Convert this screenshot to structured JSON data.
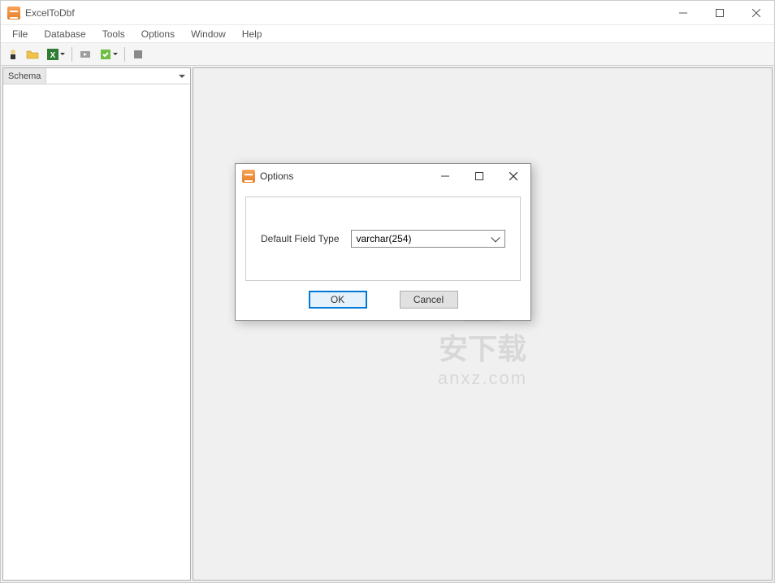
{
  "app": {
    "title": "ExcelToDbf"
  },
  "menu": {
    "file": "File",
    "database": "Database",
    "tools": "Tools",
    "options": "Options",
    "window": "Window",
    "help": "Help"
  },
  "toolbar": {
    "icons": [
      "wizard-icon",
      "open-icon",
      "excel-icon",
      "run-icon",
      "task-icon",
      "stop-icon"
    ]
  },
  "sidebar": {
    "schema_label": "Schema",
    "schema_selected": ""
  },
  "dialog": {
    "title": "Options",
    "field_label": "Default Field Type",
    "field_value": "varchar(254)",
    "ok": "OK",
    "cancel": "Cancel"
  },
  "watermark": {
    "cn": "安下载",
    "en": "anxz.com"
  }
}
